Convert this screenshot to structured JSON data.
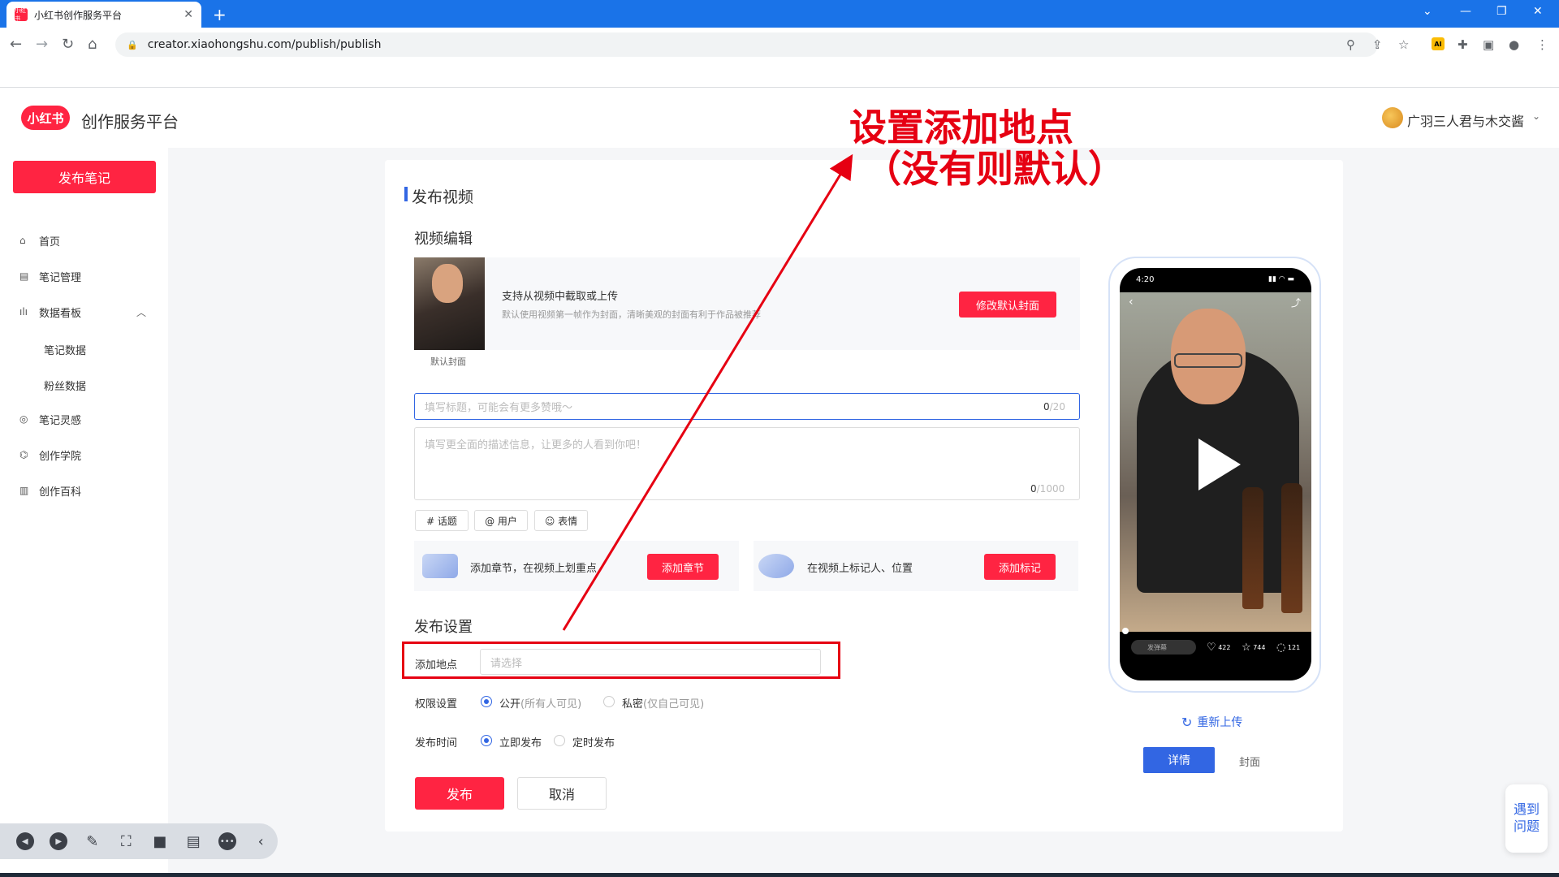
{
  "browser": {
    "tab_title": "小红书创作服务平台",
    "favicon_text": "小红书",
    "url": "creator.xiaohongshu.com/publish/publish",
    "ai_ext_label": "AI"
  },
  "header": {
    "logo_text": "小红书",
    "platform_name": "创作服务平台",
    "user_name": "广羽三人君与木交酱"
  },
  "sidebar": {
    "publish_button": "发布笔记",
    "items": [
      {
        "label": "首页",
        "icon": "home-icon"
      },
      {
        "label": "笔记管理",
        "icon": "note-icon"
      },
      {
        "label": "数据看板",
        "icon": "bar-chart-icon"
      },
      {
        "label": "笔记灵感",
        "icon": "inspiration-icon"
      },
      {
        "label": "创作学院",
        "icon": "academy-icon"
      },
      {
        "label": "创作百科",
        "icon": "wiki-icon"
      }
    ],
    "sub_items": [
      "笔记数据",
      "粉丝数据"
    ]
  },
  "main": {
    "section_title": "发布视频",
    "video_edit_title": "视频编辑",
    "cover": {
      "caption": "默认封面",
      "text1": "支持从视频中截取或上传",
      "text2": "默认使用视频第一帧作为封面，清晰美观的封面有利于作品被推荐",
      "modify_button": "修改默认封面"
    },
    "title_input": {
      "placeholder": "填写标题，可能会有更多赞哦～",
      "count": "0",
      "max": "/20"
    },
    "desc_input": {
      "placeholder": "填写更全面的描述信息，让更多的人看到你吧！",
      "count": "0",
      "max": "/1000"
    },
    "chips": {
      "topic": "# 话题",
      "user": "@ 用户",
      "emoji": "☺ 表情"
    },
    "chapter": {
      "text": "添加章节，在视频上划重点",
      "button": "添加章节"
    },
    "marker": {
      "text": "在视频上标记人、位置",
      "button": "添加标记"
    },
    "publish_settings_title": "发布设置",
    "location": {
      "label": "添加地点",
      "placeholder": "请选择"
    },
    "permission": {
      "label": "权限设置",
      "public": "公开",
      "public_hint": "(所有人可见)",
      "private": "私密",
      "private_hint": "(仅自己可见)"
    },
    "time": {
      "label": "发布时间",
      "now": "立即发布",
      "scheduled": "定时发布"
    },
    "publish_button": "发布",
    "cancel_button": "取消"
  },
  "preview": {
    "time": "4:20",
    "danmu": "发弹幕",
    "likes": "422",
    "stars": "744",
    "comments": "121",
    "reupload": "重新上传",
    "tab_detail": "详情",
    "tab_cover": "封面"
  },
  "annotation": {
    "line1": "设置添加地点",
    "line2": "（没有则默认）",
    "color": "#e60012"
  },
  "help": {
    "line1": "遇到",
    "line2": "问题"
  },
  "colors": {
    "brand": "#ff2442",
    "accent": "#3266e3",
    "chrome": "#1a73e8"
  }
}
